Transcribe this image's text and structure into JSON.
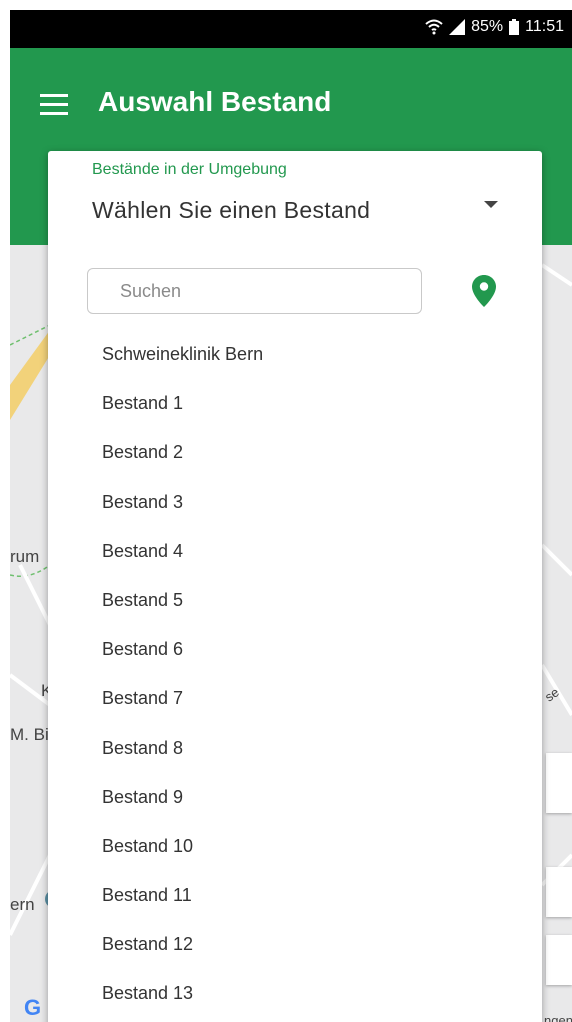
{
  "status": {
    "battery": "85%",
    "time": "11:51"
  },
  "appbar": {
    "title": "Auswahl Bestand"
  },
  "map_labels": [
    "rum",
    "K",
    "M. Bi",
    "ern",
    "ngen",
    "se",
    "G"
  ],
  "dropdown": {
    "label": "Bestände in der Umgebung",
    "value": "Wählen Sie einen Bestand",
    "search_placeholder": "Suchen",
    "items": [
      "Schweineklinik Bern",
      "Bestand 1",
      "Bestand 2",
      "Bestand 3",
      "Bestand 4",
      "Bestand 5",
      "Bestand 6",
      "Bestand 7",
      "Bestand 8",
      "Bestand 9",
      "Bestand 10",
      "Bestand 11",
      "Bestand 12",
      "Bestand 13"
    ]
  },
  "colors": {
    "primary": "#22984e",
    "statusbar": "#000000"
  },
  "icons": {
    "menu": "hamburger-icon",
    "location": "location-pin-icon",
    "wifi": "wifi-icon",
    "signal": "signal-icon",
    "battery": "battery-icon"
  }
}
